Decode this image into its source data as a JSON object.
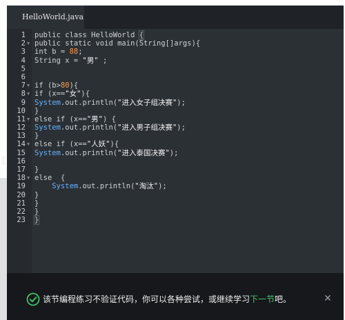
{
  "tab": {
    "label": "HelloWorld.java"
  },
  "code_lines": [
    {
      "n": "1",
      "fold": false,
      "parts": [
        {
          "t": "public class HelloWorld ",
          "c": ""
        },
        {
          "t": "{",
          "c": "bracket-hl"
        }
      ]
    },
    {
      "n": "2",
      "fold": true,
      "parts": [
        {
          "t": "public static void main(String[]args){",
          "c": ""
        }
      ]
    },
    {
      "n": "3",
      "fold": false,
      "parts": [
        {
          "t": "int b = ",
          "c": ""
        },
        {
          "t": "88",
          "c": "num"
        },
        {
          "t": ";",
          "c": ""
        }
      ]
    },
    {
      "n": "4",
      "fold": false,
      "parts": [
        {
          "t": "String x = ",
          "c": ""
        },
        {
          "t": "\"男\"",
          "c": "str"
        },
        {
          "t": " ;",
          "c": ""
        }
      ]
    },
    {
      "n": "5",
      "fold": false,
      "parts": []
    },
    {
      "n": "6",
      "fold": false,
      "parts": []
    },
    {
      "n": "7",
      "fold": true,
      "parts": [
        {
          "t": "if (b>",
          "c": ""
        },
        {
          "t": "80",
          "c": "num"
        },
        {
          "t": "){",
          "c": ""
        }
      ]
    },
    {
      "n": "8",
      "fold": true,
      "parts": [
        {
          "t": "if (x==",
          "c": ""
        },
        {
          "t": "\"女\"",
          "c": "str"
        },
        {
          "t": "){",
          "c": ""
        }
      ]
    },
    {
      "n": "9",
      "fold": false,
      "parts": [
        {
          "t": "System",
          "c": "kw"
        },
        {
          "t": ".out.println(",
          "c": ""
        },
        {
          "t": "\"进入女子组决赛\"",
          "c": "str"
        },
        {
          "t": ");",
          "c": ""
        }
      ]
    },
    {
      "n": "10",
      "fold": false,
      "parts": [
        {
          "t": "}",
          "c": ""
        }
      ]
    },
    {
      "n": "11",
      "fold": true,
      "parts": [
        {
          "t": "else if (x==",
          "c": ""
        },
        {
          "t": "\"男\"",
          "c": "str"
        },
        {
          "t": ") {",
          "c": ""
        }
      ]
    },
    {
      "n": "12",
      "fold": false,
      "parts": [
        {
          "t": "System",
          "c": "kw"
        },
        {
          "t": ".out.println(",
          "c": ""
        },
        {
          "t": "\"进入男子组决赛\"",
          "c": "str"
        },
        {
          "t": ");",
          "c": ""
        }
      ]
    },
    {
      "n": "13",
      "fold": false,
      "parts": [
        {
          "t": "}",
          "c": ""
        }
      ]
    },
    {
      "n": "14",
      "fold": true,
      "parts": [
        {
          "t": "else if (x==",
          "c": ""
        },
        {
          "t": "\"人妖\"",
          "c": "str"
        },
        {
          "t": "){",
          "c": ""
        }
      ]
    },
    {
      "n": "15",
      "fold": false,
      "parts": [
        {
          "t": "System",
          "c": "kw"
        },
        {
          "t": ".out.println(",
          "c": ""
        },
        {
          "t": "\"进入泰国决赛\"",
          "c": "str"
        },
        {
          "t": ");",
          "c": ""
        }
      ]
    },
    {
      "n": "16",
      "fold": false,
      "parts": []
    },
    {
      "n": "17",
      "fold": false,
      "parts": [
        {
          "t": "}",
          "c": ""
        }
      ]
    },
    {
      "n": "18",
      "fold": true,
      "parts": [
        {
          "t": "else  {",
          "c": ""
        }
      ]
    },
    {
      "n": "19",
      "fold": false,
      "parts": [
        {
          "t": "    System",
          "c": "kw"
        },
        {
          "t": ".out.println(",
          "c": ""
        },
        {
          "t": "\"淘汰\"",
          "c": "str"
        },
        {
          "t": ");",
          "c": ""
        }
      ]
    },
    {
      "n": "20",
      "fold": false,
      "parts": [
        {
          "t": "}",
          "c": ""
        }
      ]
    },
    {
      "n": "21",
      "fold": false,
      "parts": [
        {
          "t": "}",
          "c": ""
        }
      ]
    },
    {
      "n": "22",
      "fold": false,
      "parts": [
        {
          "t": "}",
          "c": ""
        }
      ]
    },
    {
      "n": "23",
      "fold": false,
      "parts": [
        {
          "t": "}",
          "c": "bracket-hl"
        }
      ]
    }
  ],
  "footer": {
    "message_prefix": "该节编程练习不验证代码，你可以各种尝试，或继续学习",
    "link_label": "下一节",
    "message_suffix": "吧。"
  },
  "colors": {
    "accent": "#3ec46d",
    "editor_bg": "#2b3035"
  },
  "icons": {
    "check": "check-circle-icon",
    "close": "close-icon"
  }
}
